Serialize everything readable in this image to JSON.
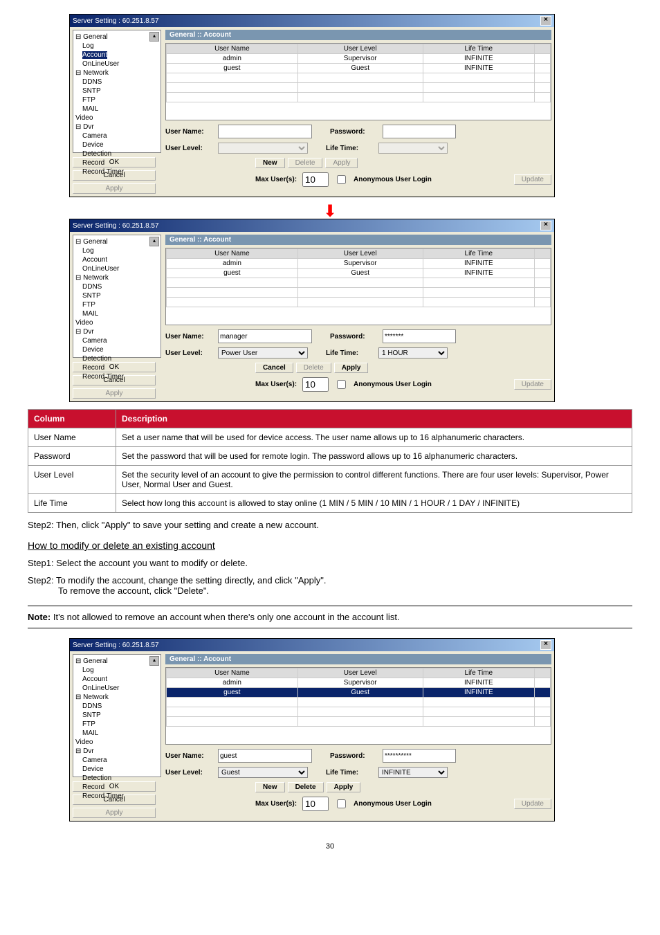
{
  "dialog_title": "Server Setting : 60.251.8.57",
  "tree_items": [
    "General",
    "Log",
    "Account",
    "OnLineUser",
    "Network",
    "DDNS",
    "SNTP",
    "FTP",
    "MAIL",
    "Video",
    "Dvr",
    "Camera",
    "Device",
    "Detection",
    "Record",
    "Record Timer"
  ],
  "pane_title": "General :: Account",
  "grid": {
    "headers": [
      "User Name",
      "User Level",
      "Life Time"
    ],
    "rows": [
      [
        "admin",
        "Supervisor",
        "INFINITE"
      ],
      [
        "guest",
        "Guest",
        "INFINITE"
      ]
    ]
  },
  "labels": {
    "username": "User Name:",
    "password": "Password:",
    "userlevel": "User Level:",
    "lifetime": "Life Time:",
    "new": "New",
    "cancel": "Cancel",
    "delete": "Delete",
    "apply": "Apply",
    "ok": "OK",
    "maxuser": "Max User(s):",
    "maxval": "10",
    "anon": "Anonymous User Login",
    "update": "Update"
  },
  "dlg2": {
    "username_val": "manager",
    "password_val": "*******",
    "level_val": "Power User",
    "life_val": "1 HOUR"
  },
  "dlg3": {
    "username_val": "guest",
    "password_val": "**********",
    "level_val": "Guest",
    "life_val": "INFINITE"
  },
  "desc": {
    "h1": "Column",
    "h2": "Description",
    "rows": [
      [
        "User Name",
        "Set a user name that will be used for device access. The user name allows up to 16 alphanumeric characters."
      ],
      [
        "Password",
        "Set the password that will be used for remote login. The password allows up to 16 alphanumeric characters."
      ],
      [
        "User Level",
        "Set the security level of an account to give the permission to control different functions. There are four user levels: Supervisor, Power User, Normal User and Guest."
      ],
      [
        "Life Time",
        "Select how long this account is allowed to stay online (1 MIN / 5 MIN / 10 MIN / 1 HOUR / 1 DAY / INFINITE)"
      ]
    ]
  },
  "step2a": "Step2: Then, click \"Apply\" to save your setting and create a new account.",
  "subhead": "How to modify or delete an existing account",
  "step1b": "Step1: Select the account you want to modify or delete.",
  "step2b": "Step2: To modify the account, change the setting directly, and click \"Apply\".",
  "step2b2": "To remove the account, click \"Delete\".",
  "note_label": "Note:",
  "note_text": "It's not allowed to remove an account when there's only one account in the account list.",
  "pagenum": "30"
}
